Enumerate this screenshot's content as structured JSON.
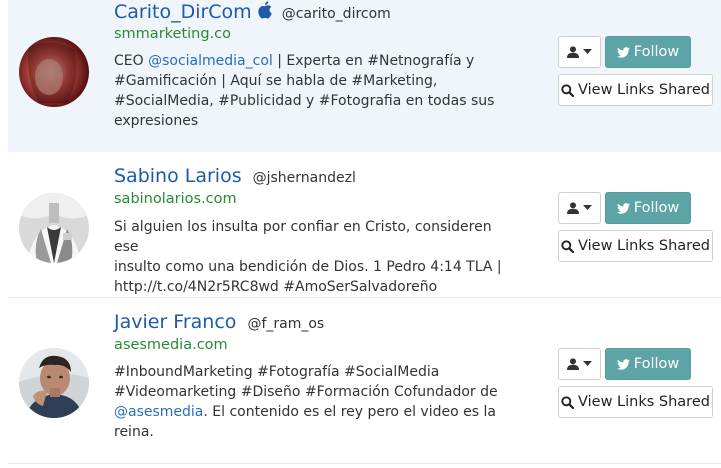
{
  "profiles": [
    {
      "name": "Carito_DirCom",
      "handle": "@carito_dircom",
      "website": "smmarketing.co",
      "bio_lines": [
        [
          "CEO ",
          "@socialmedia_col",
          " | Experta en #Netnografía y"
        ],
        [
          "#Gamificación | Aquí se habla de #Marketing,"
        ],
        [
          "#SocialMedia, #Publicidad y #Fotografia en todas sus"
        ],
        [
          "expresiones"
        ]
      ],
      "follow_label": "Follow",
      "links_label": "View Links Shared"
    },
    {
      "name": "Sabino Larios",
      "handle": "@jshernandezl",
      "website": "sabinolarios.com",
      "bio_lines": [
        [
          "Si alguien los insulta por confiar en Cristo, consideren ese"
        ],
        [
          "insulto como una bendición de Dios. 1 Pedro 4:14 TLA |"
        ],
        [
          "http://t.co/4N2r5RC8wd #AmoSerSalvadoreño"
        ]
      ],
      "follow_label": "Follow",
      "links_label": "View Links Shared"
    },
    {
      "name": "Javier Franco",
      "handle": "@f_ram_os",
      "website": "asesmedia.com",
      "bio_lines": [
        [
          "#InboundMarketing #Fotografía #SocialMedia"
        ],
        [
          "#Videomarketing #Diseño #Formación Cofundador de"
        ],
        [
          "",
          "@asesmedia",
          ". El contenido es el rey pero el video es la"
        ],
        [
          "reina."
        ]
      ],
      "follow_label": "Follow",
      "links_label": "View Links Shared"
    }
  ],
  "icons": {
    "verified": "apple-icon",
    "user_menu": "user-icon",
    "dropdown": "caret-down-icon",
    "follow": "twitter-bird-icon",
    "links": "search-icon"
  },
  "colors": {
    "name": "#1e5aa8",
    "website": "#2a8a34",
    "mention": "#2a6db8",
    "follow_button": "#5da4a6",
    "highlight_row": "#f0f5fb"
  }
}
